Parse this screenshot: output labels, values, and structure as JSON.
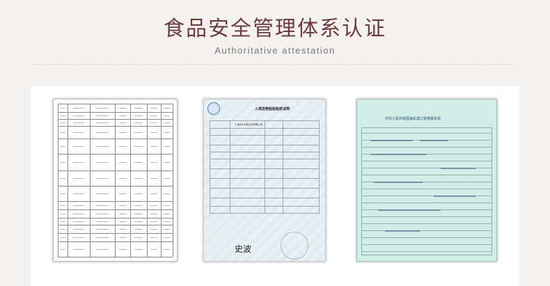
{
  "header": {
    "title": "食品安全管理体系认证",
    "subtitle": "Authoritative attestation"
  },
  "documents": [
    {
      "name": "test-report",
      "kind": "table-report"
    },
    {
      "name": "inspection-certificate",
      "doc_title": "入境货物检验检疫证明",
      "company": "上海###进出口有限公司",
      "signature": "史波"
    },
    {
      "name": "customs-declaration",
      "doc_title": "中华人民共和国海关进口货物报关单"
    }
  ]
}
